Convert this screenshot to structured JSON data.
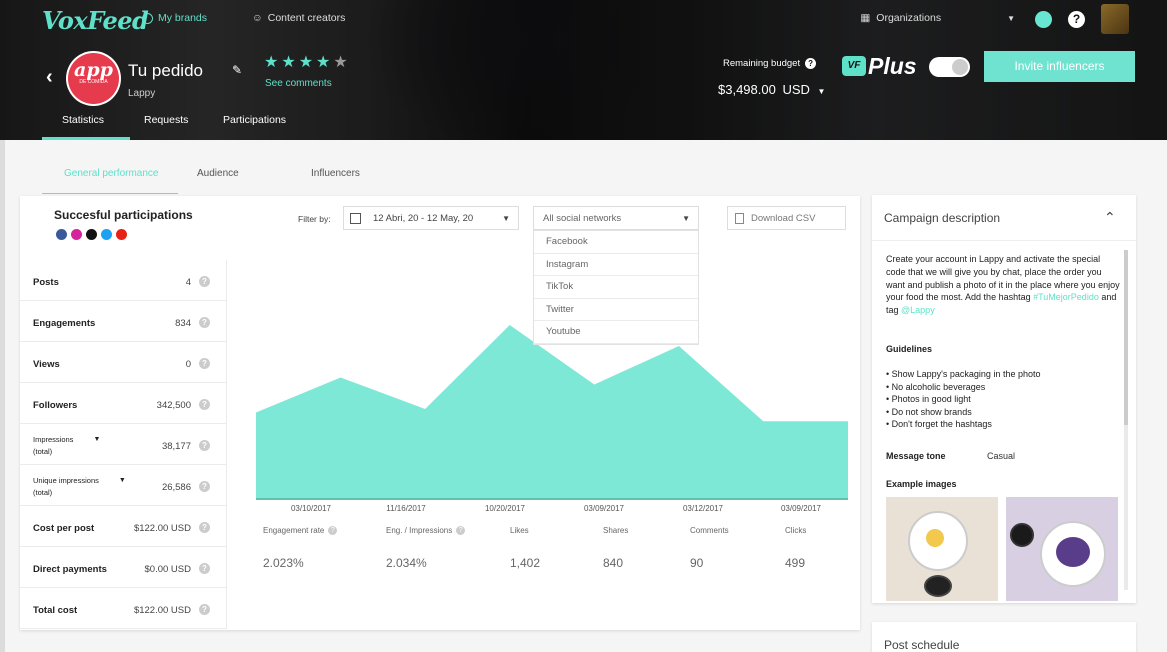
{
  "topbar": {
    "logo": "VoxFeed",
    "my_brands": "My brands",
    "content_creators": "Content creators",
    "organizations": "Organizations"
  },
  "brand": {
    "logo_text": "app",
    "logo_sub": "DE COMIDA",
    "name": "Tu pedido",
    "company": "Lappy",
    "rating": 4,
    "rating_max": 5,
    "see_comments": "See comments"
  },
  "budget": {
    "label": "Remaining budget",
    "value": "$3,498.00",
    "currency": "USD"
  },
  "plan": {
    "badge": "VF",
    "name": "Plus"
  },
  "invite_button": "Invite influencers",
  "subnav": {
    "statistics": "Statistics",
    "requests": "Requests",
    "participations": "Participations"
  },
  "tabs": {
    "general": "General performance",
    "audience": "Audience",
    "influencers": "Influencers"
  },
  "participations_title": "Succesful participations",
  "filter": {
    "label": "Filter by:",
    "date_range": "12 Abri, 20 - 12 May, 20",
    "network": "All social networks",
    "network_options": [
      "Facebook",
      "Instagram",
      "TikTok",
      "Twitter",
      "Youtube"
    ],
    "download": "Download CSV"
  },
  "stats": [
    {
      "label": "Posts",
      "value": "4"
    },
    {
      "label": "Engagements",
      "value": "834"
    },
    {
      "label": "Views",
      "value": "0"
    },
    {
      "label": "Followers",
      "value": "342,500"
    },
    {
      "label": "Impressions",
      "sub": "(total)",
      "value": "38,177"
    },
    {
      "label": "Unique impressions",
      "sub": "(total)",
      "value": "26,586"
    },
    {
      "label": "Cost per post",
      "value": "$122.00 USD"
    },
    {
      "label": "Direct payments",
      "value": "$0.00 USD"
    },
    {
      "label": "Total cost",
      "value": "$122.00 USD"
    }
  ],
  "chart_data": {
    "type": "area",
    "x": [
      "03/10/2017",
      "11/16/2017",
      "10/20/2017",
      "03/09/2017",
      "03/12/2017",
      "03/09/2017"
    ],
    "values": [
      50,
      70,
      52,
      100,
      66,
      88,
      45,
      45
    ],
    "grid": false,
    "color": "#7ee8d7"
  },
  "metrics": [
    {
      "label": "Engagement rate",
      "value": "2.023%"
    },
    {
      "label": "Eng. / Impressions",
      "value": "2.034%"
    },
    {
      "label": "Likes",
      "value": "1,402"
    },
    {
      "label": "Shares",
      "value": "840"
    },
    {
      "label": "Comments",
      "value": "90"
    },
    {
      "label": "Clicks",
      "value": "499"
    }
  ],
  "description": {
    "title": "Campaign description",
    "text": "Create your account in Lappy and activate the special code that we will give you by chat, place the order you want and publish a photo of it in the place where you enjoy your food the most. Add the hashtag",
    "hashtag": "#TuMejorPedido",
    "and_tag": "and tag",
    "mention": "@Lappy",
    "guidelines_title": "Guidelines",
    "guidelines": [
      "• Show Lappy's packaging in the photo",
      "• No alcoholic beverages",
      "• Photos in good light",
      "• Do not show brands",
      "• Don't forget the hashtags"
    ],
    "tone_label": "Message tone",
    "tone_value": "Casual",
    "examples_title": "Example images"
  },
  "schedule_title": "Post schedule",
  "colors": {
    "accent": "#5fe0c9",
    "brand_red": "#e63a4d"
  }
}
